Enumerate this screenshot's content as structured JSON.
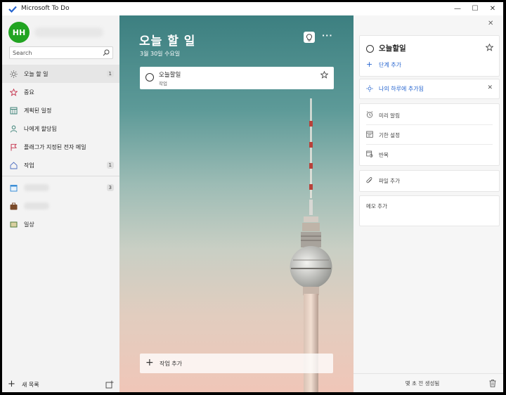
{
  "app": {
    "title": "Microsoft To Do"
  },
  "window_controls": {
    "minimize": "—",
    "maximize": "☐",
    "close": "✕"
  },
  "user": {
    "initials": "HH"
  },
  "search": {
    "placeholder": "Search"
  },
  "sidebar": {
    "items": [
      {
        "label": "오늘 할 일",
        "count": "1",
        "icon": "sun-icon"
      },
      {
        "label": "중요",
        "icon": "star-icon"
      },
      {
        "label": "계획된 일정",
        "icon": "calendar-grid-icon"
      },
      {
        "label": "나에게 할당됨",
        "icon": "person-icon"
      },
      {
        "label": "플래그가 지정된 전자 메일",
        "icon": "flag-icon"
      },
      {
        "label": "작업",
        "count": "1",
        "icon": "home-icon"
      }
    ],
    "lists": [
      {
        "count": "3",
        "icon": "calendar-list-icon"
      },
      {
        "icon": "briefcase-list-icon"
      },
      {
        "label": "일상",
        "icon": "picture-list-icon"
      }
    ],
    "new_list": "새 목록"
  },
  "main": {
    "title": "오늘 할 일",
    "date": "3월 30일 수요일",
    "more": "···",
    "tasks": [
      {
        "title": "오늘할일",
        "subtitle": "작업"
      }
    ],
    "add_task": "작업 추가"
  },
  "detail": {
    "close": "✕",
    "task_title": "오늘할일",
    "add_step": "단계 추가",
    "my_day": "나의 하루에 추가됨",
    "remind": "미리 알림",
    "due": "기한 설정",
    "repeat": "반복",
    "add_file": "파일 추가",
    "note": "메모 추가",
    "created": "몇 초 전 생성됨"
  },
  "colors": {
    "accent": "#2564cf",
    "avatar": "#22a422",
    "flag": "#c4314b"
  }
}
